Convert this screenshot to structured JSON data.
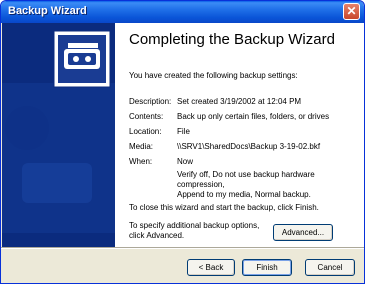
{
  "window": {
    "title": "Backup Wizard"
  },
  "heading": "Completing the Backup Wizard",
  "intro": "You have created the following backup settings:",
  "settings": [
    {
      "label": "Description:",
      "value": "Set created 3/19/2002 at 12:04 PM"
    },
    {
      "label": "Contents:",
      "value": "Back up only certain files, folders, or drives"
    },
    {
      "label": "Location:",
      "value": "File"
    },
    {
      "label": "Media:",
      "value": "\\\\SRV1\\SharedDocs\\Backup 3-19-02.bkf"
    },
    {
      "label": "When:",
      "value": "Now"
    }
  ],
  "options_line1": "Verify off, Do not use backup hardware compression,",
  "options_line2": "Append to my media, Normal backup.",
  "close_text": "To close this wizard and start the backup, click Finish.",
  "advanced_text_line1": "To specify additional backup options,",
  "advanced_text_line2": "click Advanced.",
  "buttons": {
    "advanced": "Advanced...",
    "back": "< Back",
    "finish": "Finish",
    "cancel": "Cancel"
  },
  "icons": {
    "close": "close-icon",
    "wizard": "backup-wizard-icon"
  },
  "colors": {
    "sidepanel": "#0b2b7e",
    "titlebar": "#0a55d8",
    "dialog": "#ece9d8"
  }
}
